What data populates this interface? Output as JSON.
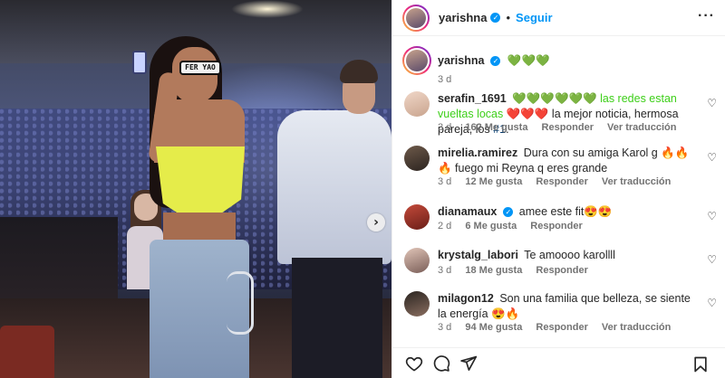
{
  "post": {
    "username": "yarishna",
    "follow_label": "Seguir",
    "caption_emoji": "💚💚💚",
    "time": "3 d",
    "more_label": "···",
    "photo_glasses_text": "FER YAO"
  },
  "comments": [
    {
      "username": "serafin_1691",
      "text_parts": [
        "💚💚💚💚💚💚 las redes estan vueltas locas ",
        "❤️❤️❤️",
        " la mejor noticia, hermosa pareja, los ",
        "#1",
        "."
      ],
      "time": "3 d",
      "likes": "162 Me gusta",
      "reply": "Responder",
      "translation": "Ver traducción"
    },
    {
      "username": "mirelia.ramirez",
      "text": "Dura con su amiga Karol g 🔥🔥🔥 fuego mi Reyna q eres grande",
      "time": "3 d",
      "likes": "12 Me gusta",
      "reply": "Responder",
      "translation": "Ver traducción"
    },
    {
      "username": "dianamaux",
      "text": "amee este fit😍😍",
      "time": "2 d",
      "likes": "6 Me gusta",
      "reply": "Responder"
    },
    {
      "username": "krystalg_labori",
      "text": "Te amoooo karollll",
      "time": "3 d",
      "likes": "18 Me gusta",
      "reply": "Responder"
    },
    {
      "username": "milagon12",
      "text": "Son una familia que belleza, se siente la energía 😍🔥",
      "time": "3 d",
      "likes": "94 Me gusta",
      "reply": "Responder",
      "translation": "Ver traducción"
    }
  ],
  "icons": {
    "like": "heart-icon",
    "comment": "comment-icon",
    "share": "share-icon",
    "save": "bookmark-icon",
    "next": "chevron-right-icon",
    "verified": "verified-badge-icon"
  },
  "colors": {
    "accent": "#0095f6",
    "meta_text": "#737373",
    "hashtag": "#00376b",
    "crop_top": "#e5ec4a"
  }
}
